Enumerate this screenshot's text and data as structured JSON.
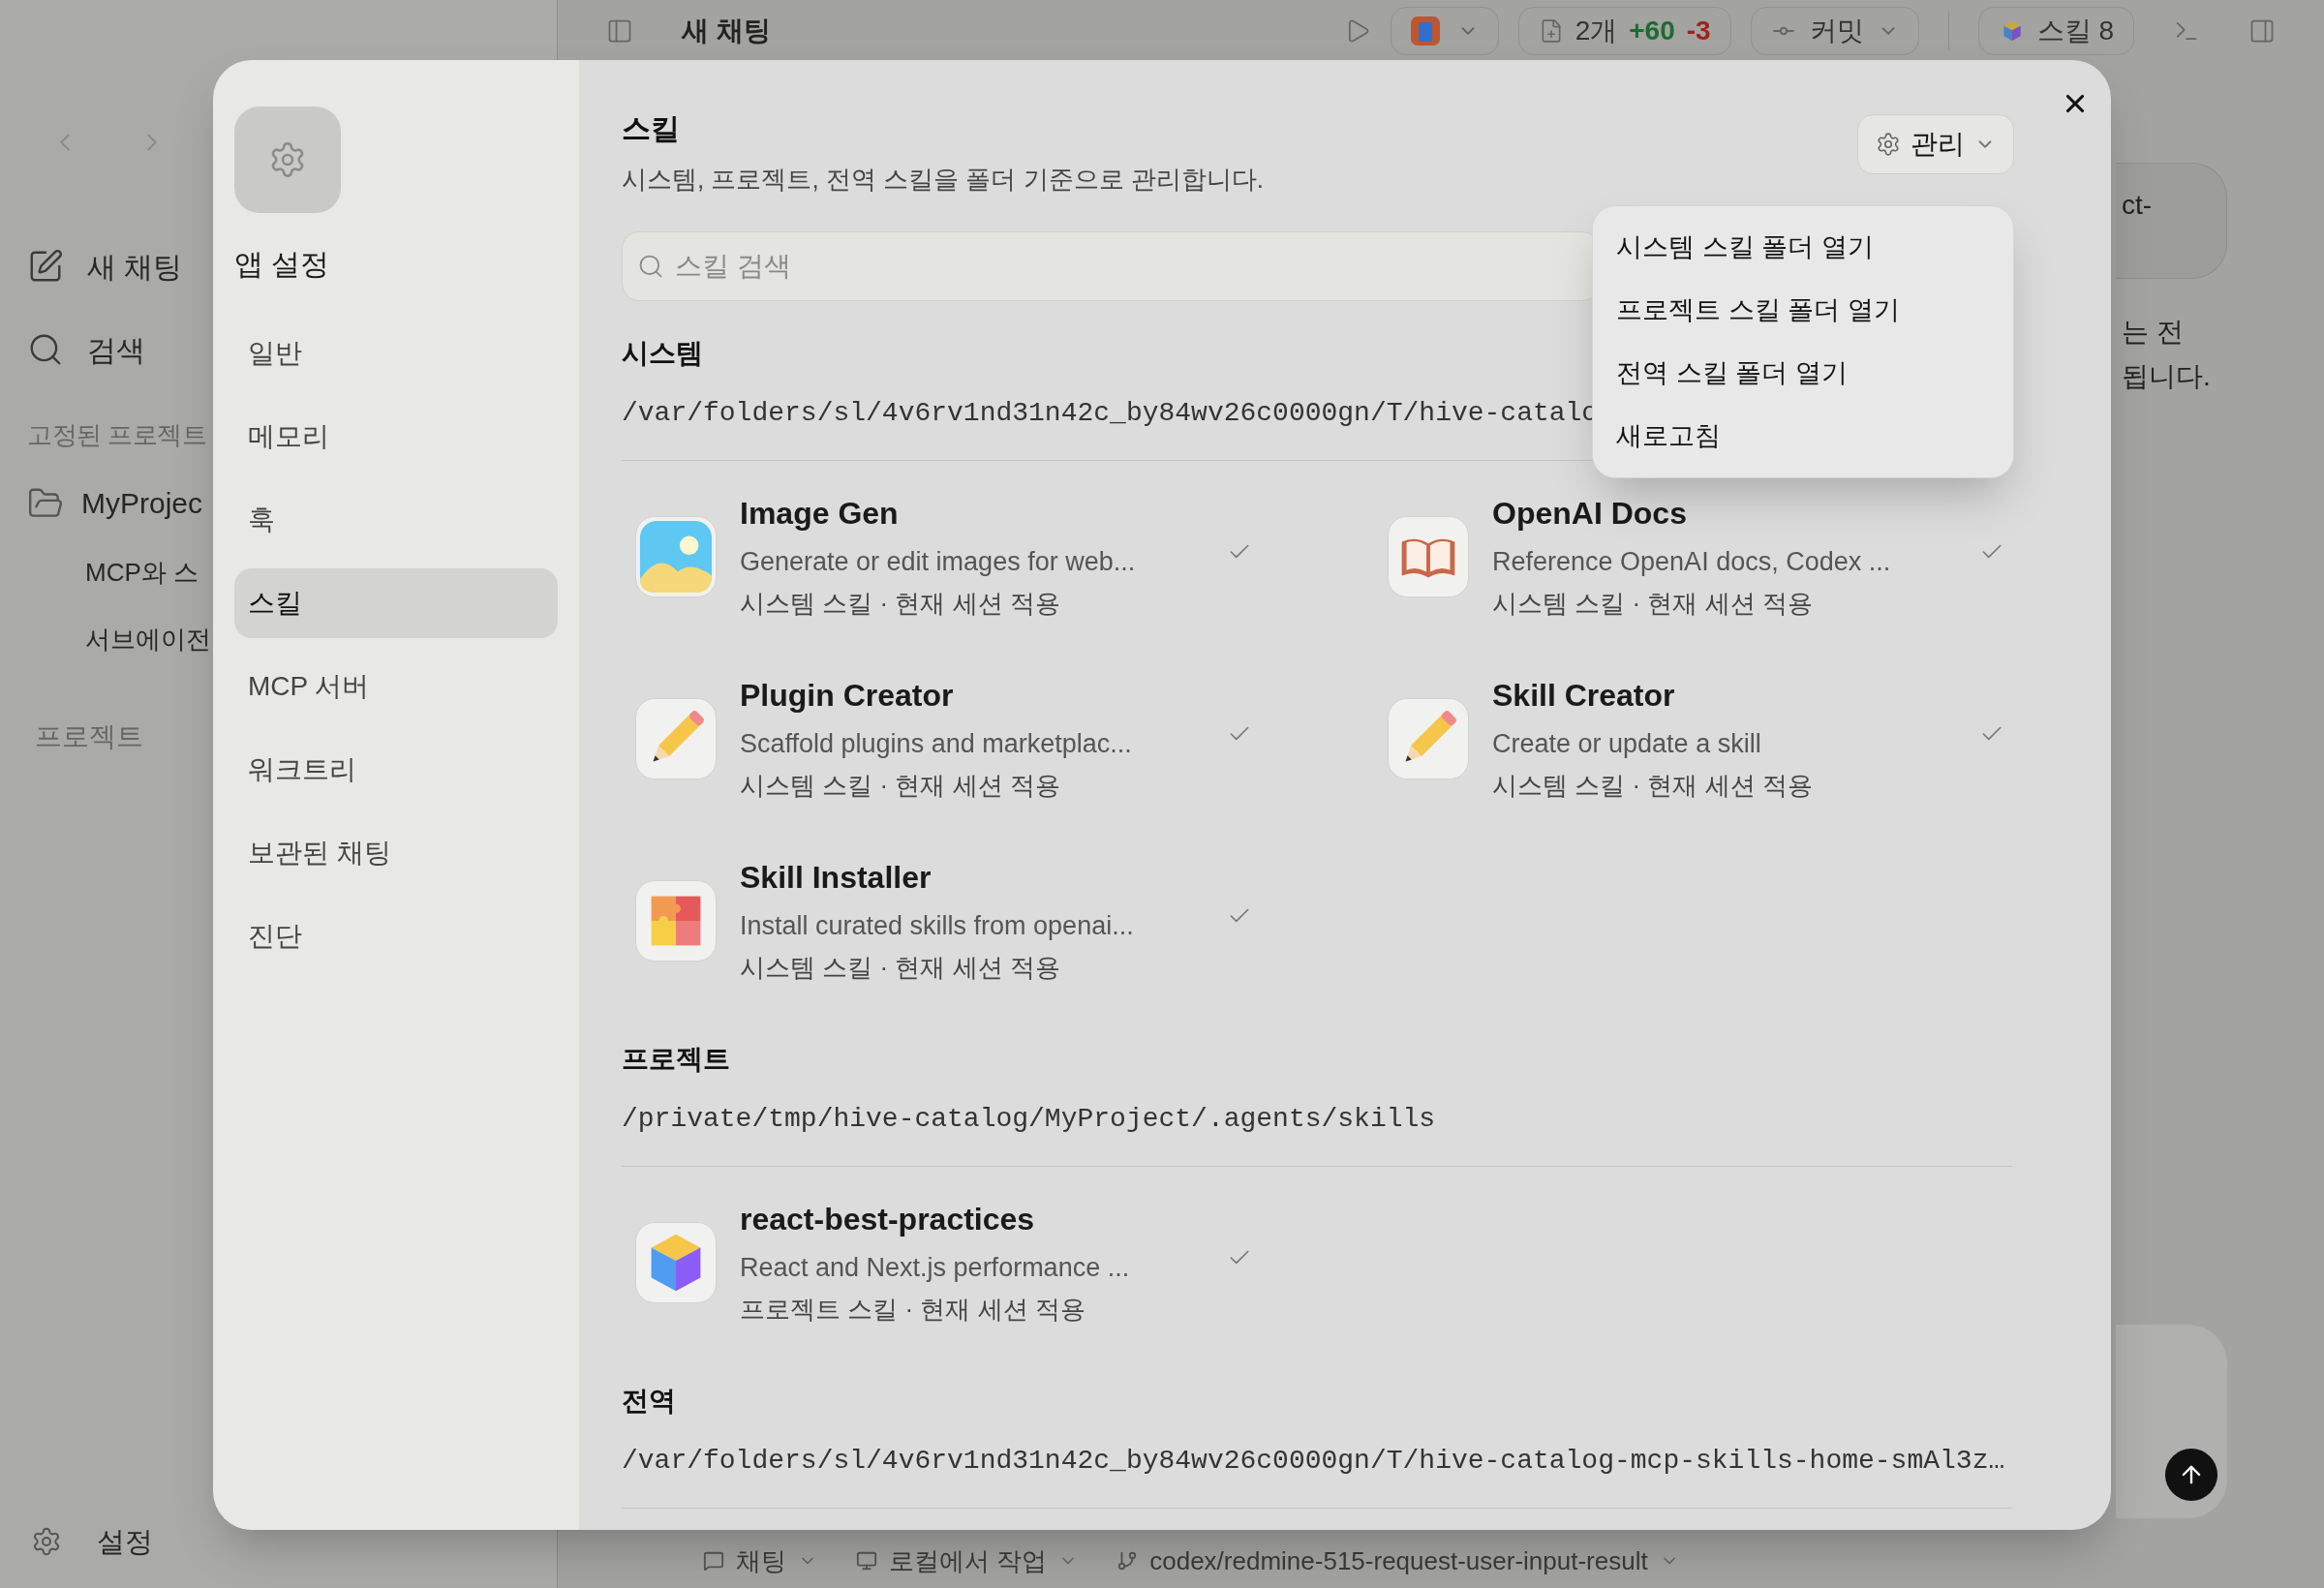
{
  "background": {
    "sidebar": {
      "items": [
        {
          "label": "새 채팅",
          "kind": "new-chat"
        },
        {
          "label": "검색",
          "kind": "search"
        }
      ],
      "pinned_heading": "고정된 프로젝트",
      "pinned": [
        {
          "label": "MyProjec",
          "children": [
            {
              "label": "MCP와 스"
            },
            {
              "label": "서브에이전"
            }
          ]
        }
      ],
      "projects_heading": "프로젝트",
      "settings": "설정"
    },
    "top_bar": {
      "title": "새 채팅",
      "changes": {
        "count": "2개",
        "added": "+60",
        "removed": "-3"
      },
      "commit": "커밋",
      "skills": "스킬 8"
    },
    "chat": {
      "bubble": "ct-",
      "lines": [
        "는 전",
        "됩니다."
      ]
    },
    "bottom_bar": [
      {
        "label": "채팅",
        "kind": "mode"
      },
      {
        "label": "로컬에서 작업",
        "kind": "local"
      },
      {
        "label": "codex/redmine-515-request-user-input-result",
        "kind": "branch"
      }
    ]
  },
  "settings": {
    "nav_title": "앱 설정",
    "nav": [
      {
        "label": "일반",
        "selected": false
      },
      {
        "label": "메모리",
        "selected": false
      },
      {
        "label": "훅",
        "selected": false
      },
      {
        "label": "스킬",
        "selected": true
      },
      {
        "label": "MCP 서버",
        "selected": false
      },
      {
        "label": "워크트리",
        "selected": false
      },
      {
        "label": "보관된 채팅",
        "selected": false
      },
      {
        "label": "진단",
        "selected": false
      }
    ],
    "page": {
      "title": "스킬",
      "subtitle": "시스템, 프로젝트, 전역 스킬을 폴더 기준으로 관리합니다.",
      "manage": "관리",
      "menu_open": true,
      "menu": [
        "시스템 스킬 폴더 열기",
        "프로젝트 스킬 폴더 열기",
        "전역 스킬 폴더 열기",
        "새로고침"
      ],
      "search_placeholder": "스킬 검색",
      "sections": [
        {
          "title": "시스템",
          "path": "/var/folders/sl/4v6rv1nd31n42c_by84wv26c0000gn/T/hive-catalo",
          "skills": [
            {
              "name": "Image Gen",
              "description": "Generate or edit images for web...",
              "meta": "시스템 스킬 · 현재 세션 적용",
              "kind": "image",
              "enabled": true
            },
            {
              "name": "OpenAI Docs",
              "description": "Reference OpenAI docs, Codex ...",
              "meta": "시스템 스킬 · 현재 세션 적용",
              "kind": "book",
              "enabled": true
            },
            {
              "name": "Plugin Creator",
              "description": "Scaffold plugins and marketplac...",
              "meta": "시스템 스킬 · 현재 세션 적용",
              "kind": "pencil",
              "enabled": true
            },
            {
              "name": "Skill Creator",
              "description": "Create or update a skill",
              "meta": "시스템 스킬 · 현재 세션 적용",
              "kind": "pencil",
              "enabled": true
            },
            {
              "name": "Skill Installer",
              "description": "Install curated skills from openai...",
              "meta": "시스템 스킬 · 현재 세션 적용",
              "kind": "puzzle",
              "enabled": true
            }
          ]
        },
        {
          "title": "프로젝트",
          "path": "/private/tmp/hive-catalog/MyProject/.agents/skills",
          "skills": [
            {
              "name": "react-best-practices",
              "description": "React and Next.js performance ...",
              "meta": "프로젝트 스킬 · 현재 세션 적용",
              "kind": "cube",
              "enabled": true
            }
          ]
        },
        {
          "title": "전역",
          "path": "/var/folders/sl/4v6rv1nd31n42c_by84wv26c0000gn/T/hive-catalog-mcp-skills-home-smAl3z…"
        }
      ]
    }
  }
}
